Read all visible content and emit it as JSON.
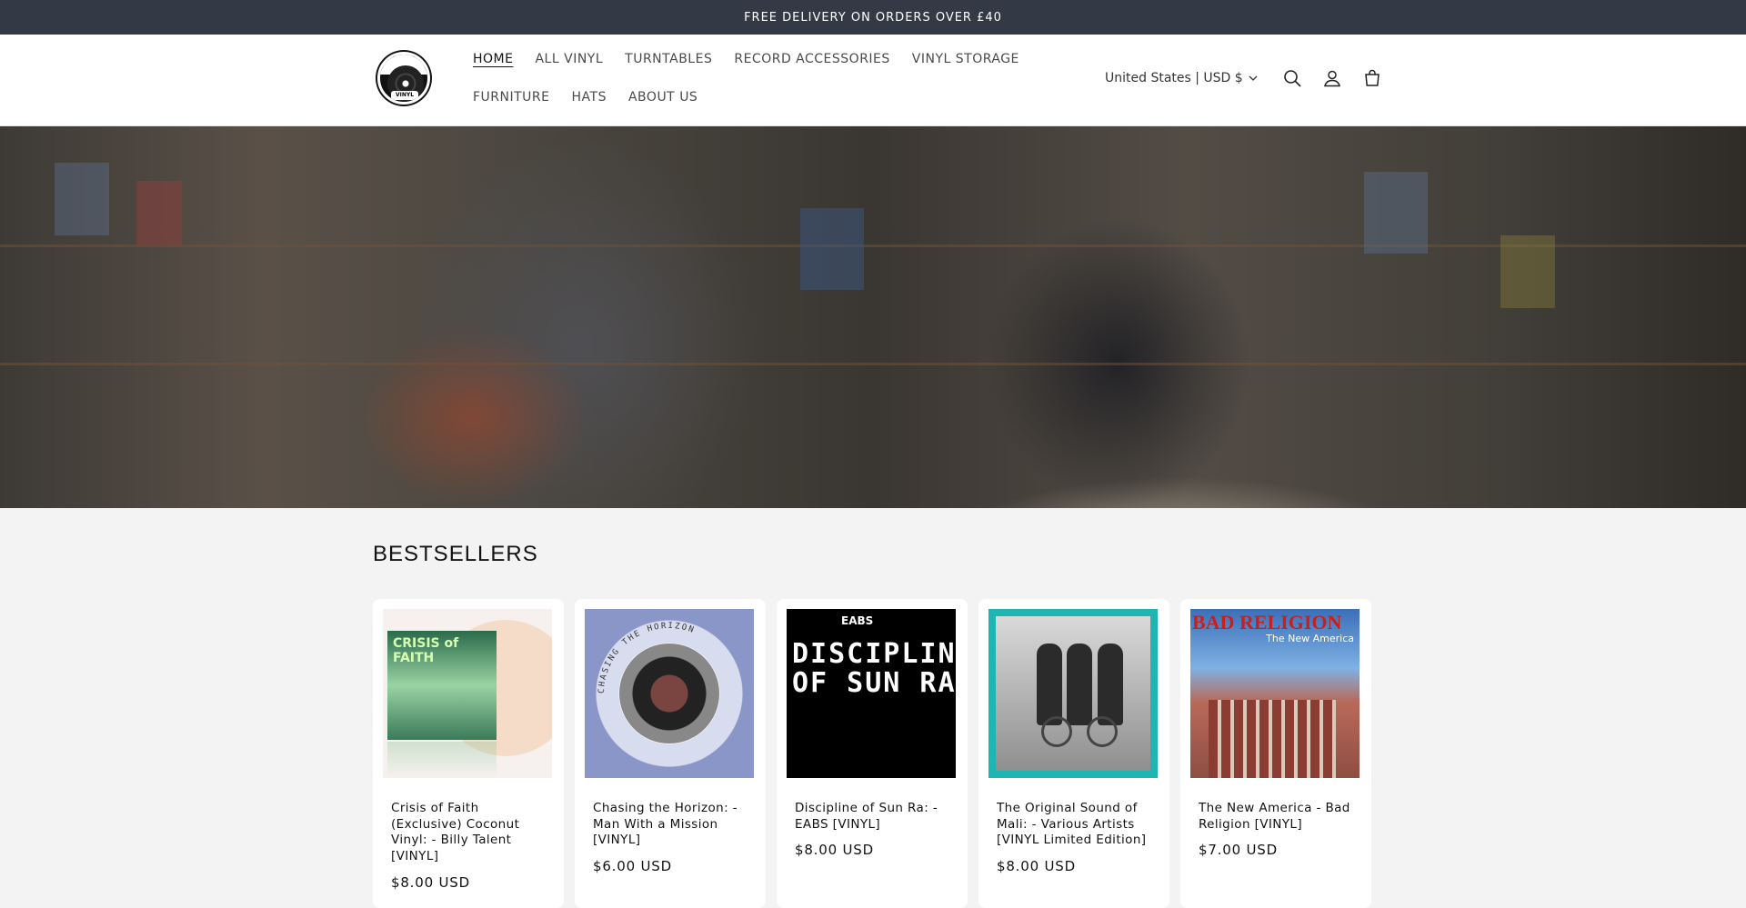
{
  "announcement": {
    "text": "FREE DELIVERY ON ORDERS OVER £40"
  },
  "header": {
    "logo_alt": "VINYL",
    "nav": [
      {
        "label": "HOME",
        "active": true
      },
      {
        "label": "ALL VINYL"
      },
      {
        "label": "TURNTABLES"
      },
      {
        "label": "RECORD ACCESSORIES"
      },
      {
        "label": "VINYL STORAGE"
      },
      {
        "label": "FURNITURE"
      },
      {
        "label": "HATS"
      },
      {
        "label": "ABOUT US"
      }
    ],
    "country_selector": "United States | USD $",
    "icons": [
      "search-icon",
      "account-icon",
      "cart-icon"
    ]
  },
  "hero": {
    "image": "record-store-browsing-photo"
  },
  "bestsellers": {
    "title": "BESTSELLERS",
    "products": [
      {
        "title": "Crisis of Faith (Exclusive) Coconut Vinyl: - Billy Talent [VINYL]",
        "price": "$8.00 USD",
        "art_text": "CRISIS of FAITH"
      },
      {
        "title": "Chasing the Horizon: - Man With a Mission [VINYL]",
        "price": "$6.00 USD",
        "art_text": "CHASING THE HORIZON"
      },
      {
        "title": "Discipline of Sun Ra: - EABS [VINYL]",
        "price": "$8.00 USD",
        "art_text": "EABS",
        "art_text_2": "DISCIPLINE OF SUN RA"
      },
      {
        "title": "The Original Sound of Mali: - Various Artists [VINYL Limited Edition]",
        "price": "$8.00 USD"
      },
      {
        "title": "The New America - Bad Religion [VINYL]",
        "price": "$7.00 USD",
        "art_text": "BAD RELIGION",
        "art_text_2": "The New America"
      }
    ]
  },
  "colors": {
    "announcement_bg": "#333a45",
    "page_bg": "#f3f3f3",
    "card_bg": "#ffffff",
    "mali_border": "#1fb5b2"
  }
}
